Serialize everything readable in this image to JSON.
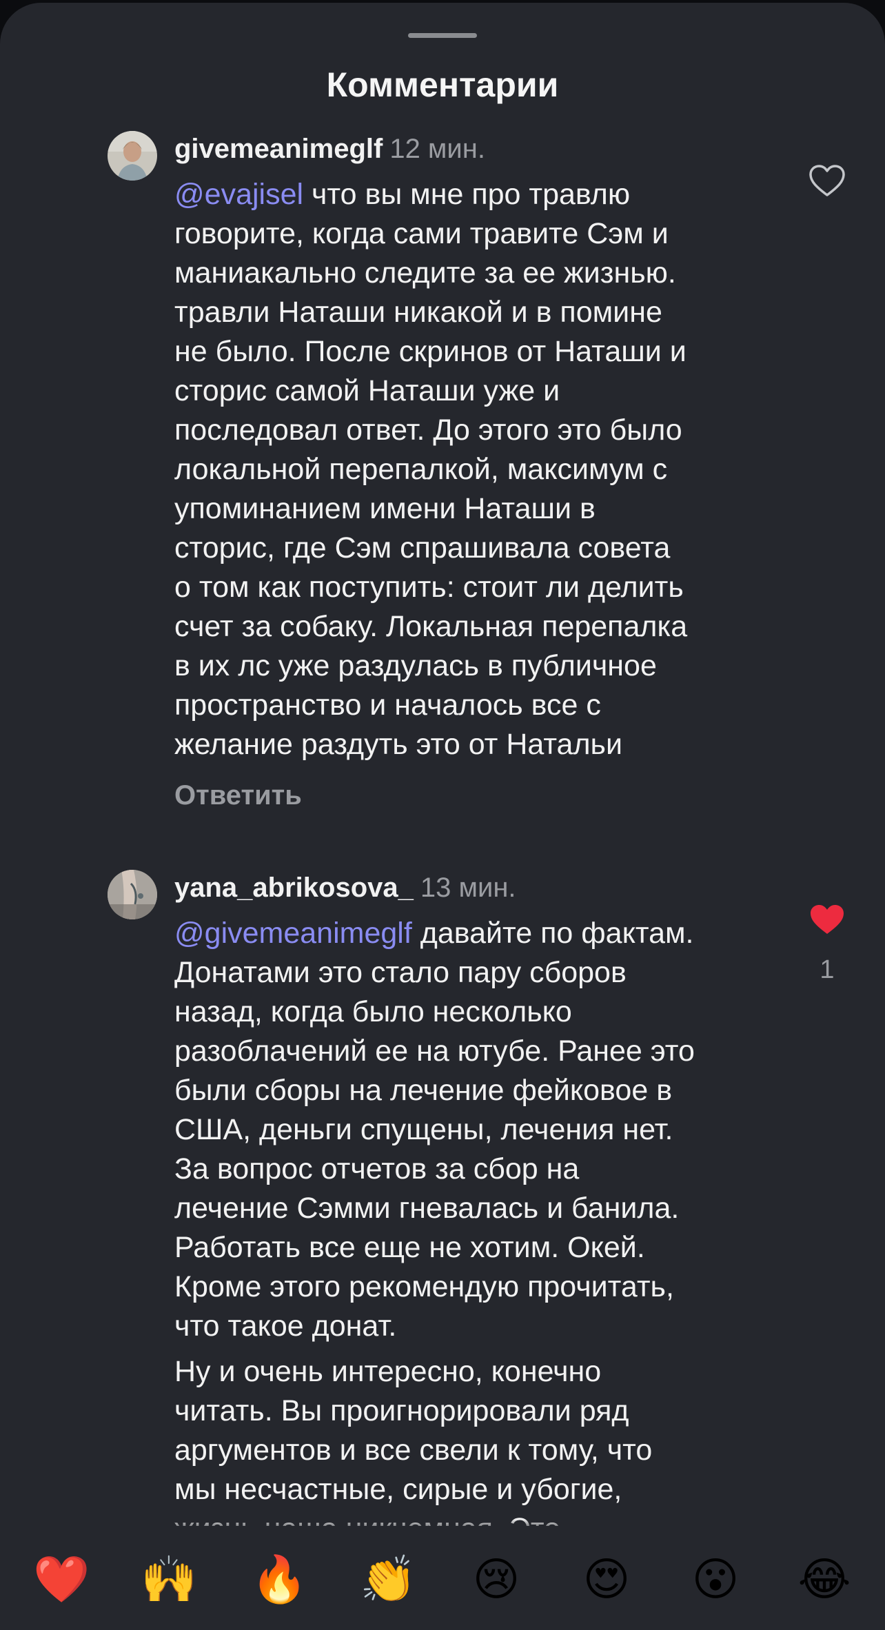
{
  "sheet": {
    "title": "Комментарии"
  },
  "comments": [
    {
      "username": "givemeanimeglf",
      "time": "12 мин.",
      "mention": "@evajisel",
      "text": " что вы мне про травлю\nговорите, когда сами травите Сэм и\nманиакально следите за ее жизнью.\nтравли Наташи никакой и в помине\nне было. После скринов от Наташи и\nсторис самой Наташи уже и\nпоследовал ответ. До этого это было\nлокальной перепалкой, максимум с\nупоминанием имени Наташи в\nсторис,  где Сэм спрашивала совета\nо том как поступить: стоит ли делить\nсчет за собаку. Локальная перепалка\nв их лс уже раздулась в публичное\nпространство и началось все с\nжелание раздуть это от Натальи",
      "reply_label": "Ответить",
      "liked": false
    },
    {
      "username": "yana_abrikosova_",
      "time": "13 мин.",
      "mention": "@givemeanimeglf",
      "text": " давайте по фактам.\nДонатами это стало пару сборов\nназад, когда было несколько\nразоблачений ее на ютубе. Ранее это\nбыли сборы на лечение фейковое в\nСША, деньги спущены, лечения нет.\nЗа вопрос отчетов за сбор на\nлечение Сэмми гневалась и банила.\nРаботать все еще не хотим. Окей.\nКроме этого рекомендую прочитать,\nчто такое донат.",
      "text_continued": "Ну и очень интересно, конечно\nчитать. Вы проигнорировали ряд\nаргументов и все свели к тому, что\nмы несчастные, сирые и убогие,\nжизнь наша никчемная. Это",
      "liked": true,
      "like_count": "1"
    }
  ],
  "colors": {
    "background": "#25272d",
    "text": "#f2f2f2",
    "secondary_text": "#9a9ca1",
    "mention": "#8a8cf2",
    "like_active": "#ed2b3f"
  },
  "emoji_bar": [
    {
      "icon": "red-heart",
      "glyph": "❤️"
    },
    {
      "icon": "raising-hands",
      "glyph": "🙌"
    },
    {
      "icon": "fire",
      "glyph": "🔥"
    },
    {
      "icon": "clapping-hands",
      "glyph": "👏"
    },
    {
      "icon": "crying-face",
      "glyph": "😢"
    },
    {
      "icon": "heart-eyes-face",
      "glyph": "😍"
    },
    {
      "icon": "surprised-face",
      "glyph": "😮"
    },
    {
      "icon": "tears-of-joy-face",
      "glyph": "😂"
    }
  ]
}
